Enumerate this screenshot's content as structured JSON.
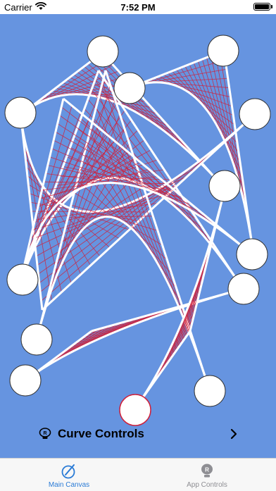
{
  "status_bar": {
    "carrier": "Carrier",
    "time": "7:52 PM",
    "icons": [
      "wifi-icon",
      "battery-icon"
    ]
  },
  "canvas": {
    "background_color": "#6694e0",
    "string_color": "#d0203a",
    "curve_color": "#ffffff"
  },
  "curve_controls": {
    "label": "Curve Controls",
    "icon": "badge-r-icon",
    "chevron": "chevron-right-icon"
  },
  "tab_bar": {
    "tabs": [
      {
        "label": "Main Canvas",
        "icon": "pen-circle-icon",
        "selected": true,
        "color": "#2a7bd6"
      },
      {
        "label": "App Controls",
        "icon": "badge-r-icon",
        "selected": false,
        "color": "#8e8e93"
      }
    ]
  }
}
